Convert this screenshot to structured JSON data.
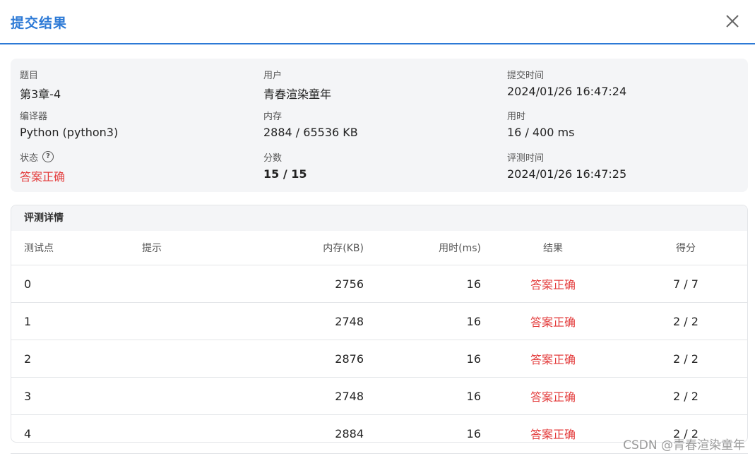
{
  "dialog": {
    "title": "提交结果",
    "close_icon": "close-icon"
  },
  "summary": {
    "problem": {
      "label": "题目",
      "value": "第3章-4"
    },
    "user": {
      "label": "用户",
      "value": "青春渲染童年"
    },
    "submit_time": {
      "label": "提交时间",
      "value": "2024/01/26 16:47:24"
    },
    "compiler": {
      "label": "编译器",
      "value": "Python (python3)"
    },
    "memory": {
      "label": "内存",
      "value": "2884 / 65536 KB"
    },
    "time_used": {
      "label": "用时",
      "value": "16 / 400 ms"
    },
    "status": {
      "label": "状态",
      "value": "答案正确",
      "help_icon": "question-circle-icon"
    },
    "score": {
      "label": "分数",
      "value": "15 / 15"
    },
    "judge_time": {
      "label": "评测时间",
      "value": "2024/01/26 16:47:25"
    }
  },
  "details": {
    "title": "评测详情",
    "columns": [
      "测试点",
      "提示",
      "内存(KB)",
      "用时(ms)",
      "结果",
      "得分"
    ],
    "rows": [
      {
        "id": "0",
        "hint": "",
        "memory": "2756",
        "time": "16",
        "result": "答案正确",
        "score": "7 / 7"
      },
      {
        "id": "1",
        "hint": "",
        "memory": "2748",
        "time": "16",
        "result": "答案正确",
        "score": "2 / 2"
      },
      {
        "id": "2",
        "hint": "",
        "memory": "2876",
        "time": "16",
        "result": "答案正确",
        "score": "2 / 2"
      },
      {
        "id": "3",
        "hint": "",
        "memory": "2748",
        "time": "16",
        "result": "答案正确",
        "score": "2 / 2"
      },
      {
        "id": "4",
        "hint": "",
        "memory": "2884",
        "time": "16",
        "result": "答案正确",
        "score": "2 / 2"
      }
    ]
  },
  "colors": {
    "accent": "#2d7ad6",
    "success_text": "#e33b3b"
  },
  "watermark": "CSDN @青春渲染童年"
}
